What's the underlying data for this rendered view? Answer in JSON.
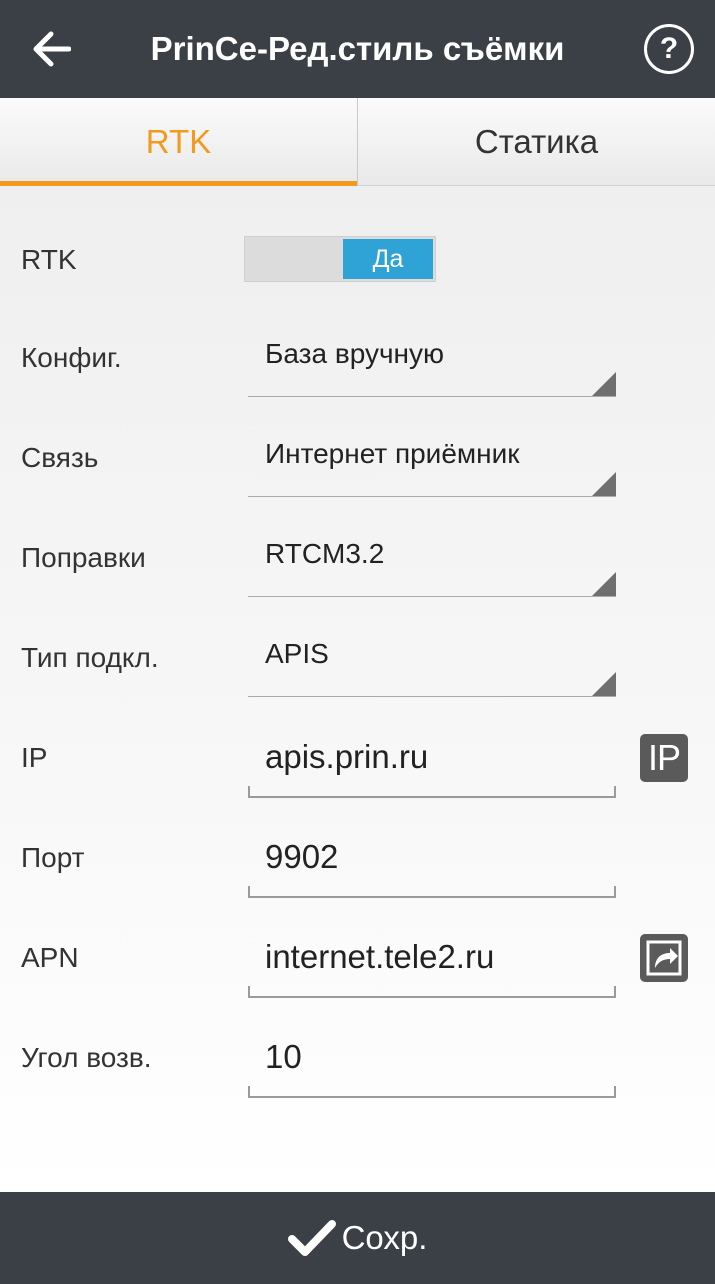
{
  "header": {
    "title": "PrinCe-Ред.стиль съёмки",
    "back_icon": "arrow-left-icon",
    "help_label": "?"
  },
  "tabs": [
    {
      "label": "RTK",
      "active": true
    },
    {
      "label": "Статика",
      "active": false
    }
  ],
  "form": {
    "rtk": {
      "label": "RTK",
      "toggle_value": "Да",
      "enabled": true
    },
    "config": {
      "label": "Конфиг.",
      "value": "База вручную"
    },
    "link": {
      "label": "Связь",
      "value": "Интернет приёмник"
    },
    "corrections": {
      "label": "Поправки",
      "value": "RTCM3.2"
    },
    "connection_type": {
      "label": "Тип подкл.",
      "value": "APIS"
    },
    "ip": {
      "label": "IP",
      "value": "apis.prin.ru",
      "button_label": "IP"
    },
    "port": {
      "label": "Порт",
      "value": "9902"
    },
    "apn": {
      "label": "APN",
      "value": "internet.tele2.ru",
      "button_icon": "external-link-icon"
    },
    "elevation_angle": {
      "label": "Угол возв.",
      "value": "10"
    }
  },
  "footer": {
    "save_label": "Сохр.",
    "save_icon": "checkmark-icon"
  },
  "colors": {
    "header_bg": "#3a4046",
    "accent": "#f39a1e",
    "toggle_on": "#2fa3d6"
  }
}
